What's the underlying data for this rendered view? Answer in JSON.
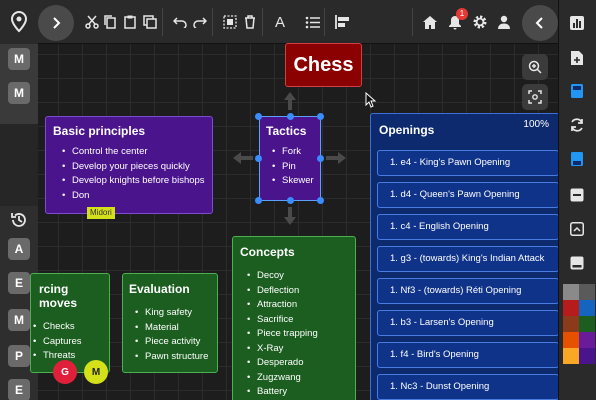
{
  "topbar": {
    "notification_count": "1",
    "text_tool_label": "A"
  },
  "left_rail": {
    "top_buttons": [
      "M",
      "M"
    ],
    "bottom_buttons": [
      "A",
      "E",
      "M",
      "P",
      "E"
    ]
  },
  "canvas": {
    "zoom_percent": "100%",
    "root": {
      "title": "Chess"
    },
    "basic": {
      "title": "Basic principles",
      "items": [
        "Control the center",
        "Develop your pieces quickly",
        "Develop knights before bishops",
        "Don"
      ]
    },
    "tactics": {
      "title": "Tactics",
      "items": [
        "Fork",
        "Pin",
        "Skewer"
      ]
    },
    "concepts": {
      "title": "Concepts",
      "items": [
        "Decoy",
        "Deflection",
        "Attraction",
        "Sacrifice",
        "Piece trapping",
        "X-Ray",
        "Desperado",
        "Zugzwang",
        "Battery"
      ]
    },
    "forcing": {
      "title": "rcing moves",
      "items": [
        "Checks",
        "Captures",
        "Threats"
      ]
    },
    "evaluation": {
      "title": "Evaluation",
      "items": [
        "King safety",
        "Material",
        "Piece activity",
        "Pawn structure"
      ]
    },
    "openings": {
      "title": "Openings",
      "items": [
        "1. e4 - King's Pawn Opening",
        "1. d4 - Queen's Pawn Opening",
        "1. c4 - English Opening",
        "1. g3 - (towards) King's Indian Attack",
        "1. Nf3 - (towards) Réti Opening",
        "1. b3 - Larsen's Opening",
        "1. f4 - Bird's Opening",
        "1. Nc3 - Dunst Opening"
      ]
    },
    "cursor_label": "Midori",
    "users": [
      "G",
      "M"
    ]
  },
  "palette": [
    "#8a8a8a",
    "#5a5a5a",
    "#b71c1c",
    "#1565c0",
    "#8b3a1a",
    "#1b5e20",
    "#e65100",
    "#6a1b9a",
    "#f9a825",
    "#4a148c"
  ]
}
